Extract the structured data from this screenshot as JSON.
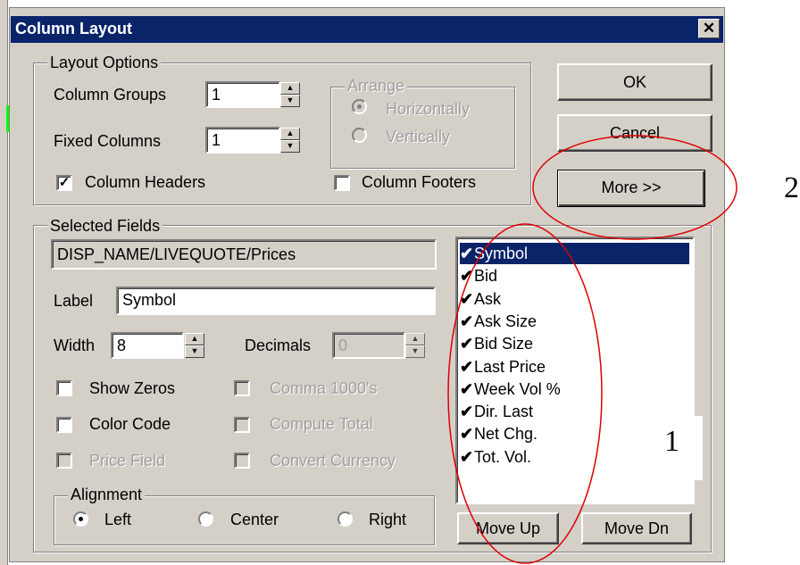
{
  "dialog": {
    "title": "Column Layout",
    "close_label": "✕"
  },
  "layout_options": {
    "legend": "Layout Options",
    "column_groups_label": "Column Groups",
    "column_groups_value": "1",
    "fixed_columns_label": "Fixed Columns",
    "fixed_columns_value": "1",
    "column_headers_label": "Column Headers",
    "column_headers_checked": true,
    "column_footers_label": "Column Footers",
    "column_footers_checked": false,
    "arrange": {
      "legend": "Arrange",
      "horizontally_label": "Horizontally",
      "vertically_label": "Vertically",
      "selected": "Horizontally"
    }
  },
  "buttons": {
    "ok": "OK",
    "cancel": "Cancel",
    "more": "More >>",
    "move_up": "Move Up",
    "move_dn": "Move Dn"
  },
  "selected_fields": {
    "legend": "Selected Fields",
    "field_path": "DISP_NAME/LIVEQUOTE/Prices",
    "label_label": "Label",
    "label_value": "Symbol",
    "width_label": "Width",
    "width_value": "8",
    "decimals_label": "Decimals",
    "decimals_value": "0",
    "options": {
      "show_zeros": "Show Zeros",
      "comma_1000s": "Comma 1000's",
      "color_code": "Color Code",
      "compute_total": "Compute Total",
      "price_field": "Price Field",
      "convert_currency": "Convert Currency"
    },
    "alignment": {
      "legend": "Alignment",
      "left": "Left",
      "center": "Center",
      "right": "Right",
      "selected": "Left"
    },
    "fields_list": [
      "Symbol",
      "Bid",
      "Ask",
      "Ask Size",
      "Bid Size",
      "Last Price",
      "Week Vol %",
      "Dir. Last",
      "Net Chg.",
      "Tot. Vol."
    ],
    "selected_item": "Symbol"
  },
  "annotations": {
    "label_1": "1",
    "label_2": "2",
    "color": "#e00000"
  },
  "colors": {
    "titlebar": "#0a246a",
    "face": "#d4d0c8",
    "highlight": "#0a246a"
  },
  "icons": {
    "check": "check-mark-icon",
    "close": "close-icon"
  }
}
